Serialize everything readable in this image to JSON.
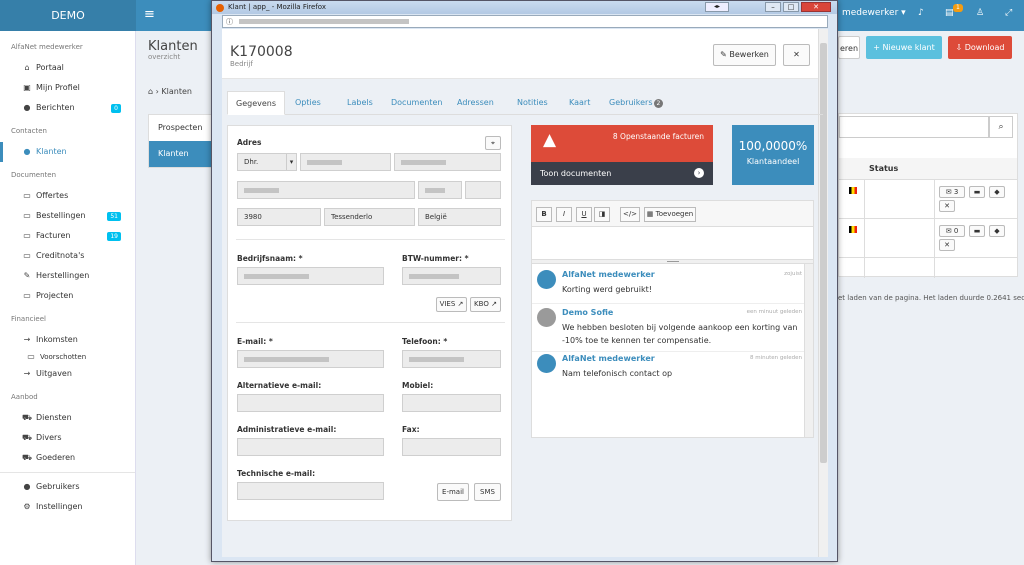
{
  "app": {
    "brand": "DEMO",
    "user": "medewerker",
    "bell_count": "1"
  },
  "sidebar": {
    "items": [
      {
        "type": "head",
        "label": "AlfaNet medewerker"
      },
      {
        "type": "item",
        "icon": "home-icon",
        "glyph": "⌂",
        "label": "Portaal"
      },
      {
        "type": "item",
        "icon": "profile-card-icon",
        "glyph": "▣",
        "label": "Mijn Profiel"
      },
      {
        "type": "item",
        "icon": "chat-bubble-icon",
        "glyph": "●",
        "label": "Berichten",
        "badge": "0"
      },
      {
        "type": "head",
        "label": "Contacten"
      },
      {
        "type": "item",
        "icon": "user-icon",
        "glyph": "●",
        "label": "Klanten",
        "active": true
      },
      {
        "type": "head",
        "label": "Documenten"
      },
      {
        "type": "item",
        "icon": "inbox-icon",
        "glyph": "▭",
        "label": "Offertes"
      },
      {
        "type": "item",
        "icon": "inbox-icon",
        "glyph": "▭",
        "label": "Bestellingen",
        "badge": "51"
      },
      {
        "type": "item",
        "icon": "inbox-icon",
        "glyph": "▭",
        "label": "Facturen",
        "badge": "19"
      },
      {
        "type": "item",
        "icon": "inbox-icon",
        "glyph": "▭",
        "label": "Creditnota's"
      },
      {
        "type": "item",
        "icon": "wrench-icon",
        "glyph": "✎",
        "label": "Herstellingen"
      },
      {
        "type": "item",
        "icon": "inbox-icon",
        "glyph": "▭",
        "label": "Projecten"
      },
      {
        "type": "head",
        "label": "Financieel"
      },
      {
        "type": "item",
        "icon": "arrow-right-icon",
        "glyph": "→",
        "label": "Inkomsten"
      },
      {
        "type": "sub",
        "icon": "inbox-icon",
        "glyph": "▭",
        "label": "Voorschotten"
      },
      {
        "type": "item",
        "icon": "arrow-right-icon",
        "glyph": "→",
        "label": "Uitgaven"
      },
      {
        "type": "head",
        "label": "Aanbod"
      },
      {
        "type": "item",
        "icon": "cart-icon",
        "glyph": "⛟",
        "label": "Diensten"
      },
      {
        "type": "item",
        "icon": "cart-icon",
        "glyph": "⛟",
        "label": "Divers"
      },
      {
        "type": "item",
        "icon": "cart-icon",
        "glyph": "⛟",
        "label": "Goederen"
      },
      {
        "type": "sep"
      },
      {
        "type": "item",
        "icon": "user-icon",
        "glyph": "●",
        "label": "Gebruikers"
      },
      {
        "type": "item",
        "icon": "gear-icon",
        "glyph": "⚙",
        "label": "Instellingen"
      }
    ]
  },
  "bg": {
    "title": "Klanten",
    "subtitle": "overzicht",
    "breadcrumb": "Klanten",
    "tabs": [
      "Prospecten",
      "Klanten"
    ],
    "btn_partial": "eren",
    "btn_new": "Nieuwe klant",
    "btn_download": "Download",
    "col_status": "Status",
    "footer": "et laden van de pagina. Het laden duurde 0.2641 seconden.",
    "row_counts": [
      "3",
      "0"
    ]
  },
  "window": {
    "title": "Klant | app_ - Mozilla Firefox"
  },
  "modal": {
    "title": "K170008",
    "subtitle": "Bedrijf",
    "edit_label": "Bewerken",
    "close_label": "✕",
    "tabs": [
      {
        "label": "Gegevens",
        "active": true
      },
      {
        "label": "Opties"
      },
      {
        "label": "Labels"
      },
      {
        "label": "Documenten"
      },
      {
        "label": "Adressen"
      },
      {
        "label": "Notities"
      },
      {
        "label": "Kaart"
      },
      {
        "label": "Gebruikers",
        "count": "2"
      }
    ],
    "form": {
      "address_label": "Adres",
      "salutation": "Dhr.",
      "postal": "3980",
      "city": "Tessenderlo",
      "country": "België",
      "company_label": "Bedrijfsnaam: *",
      "vat_label": "BTW-nummer: *",
      "vies": "VIES",
      "kbo": "KBO",
      "email_label": "E-mail: *",
      "phone_label": "Telefoon: *",
      "alt_email_label": "Alternatieve e-mail:",
      "mobile_label": "Mobiel:",
      "admin_email_label": "Administratieve e-mail:",
      "fax_label": "Fax:",
      "tech_email_label": "Technische e-mail:",
      "email_btn": "E-mail",
      "sms_btn": "SMS"
    },
    "alert": {
      "text": "8 Openstaande facturen",
      "link": "Toon documenten"
    },
    "share": {
      "value": "100,0000%",
      "label": "Klantaandeel"
    },
    "editor": {
      "add_label": "Toevoegen"
    },
    "notes": [
      {
        "name": "AlfaNet medewerker",
        "time": "zojuist",
        "text": "Korting werd gebruikt!"
      },
      {
        "name": "Demo Sofie",
        "time": "een minuut geleden",
        "text": "We hebben besloten bij volgende aankoop een korting van -10% toe te kennen ter compensatie."
      },
      {
        "name": "AlfaNet medewerker",
        "time": "8 minuten geleden",
        "text": "Nam telefonisch contact op"
      }
    ]
  },
  "colors": {
    "primary": "#3c8dbc",
    "danger": "#dd4b39",
    "info": "#5bc0de",
    "dark": "#3a3f4a"
  }
}
